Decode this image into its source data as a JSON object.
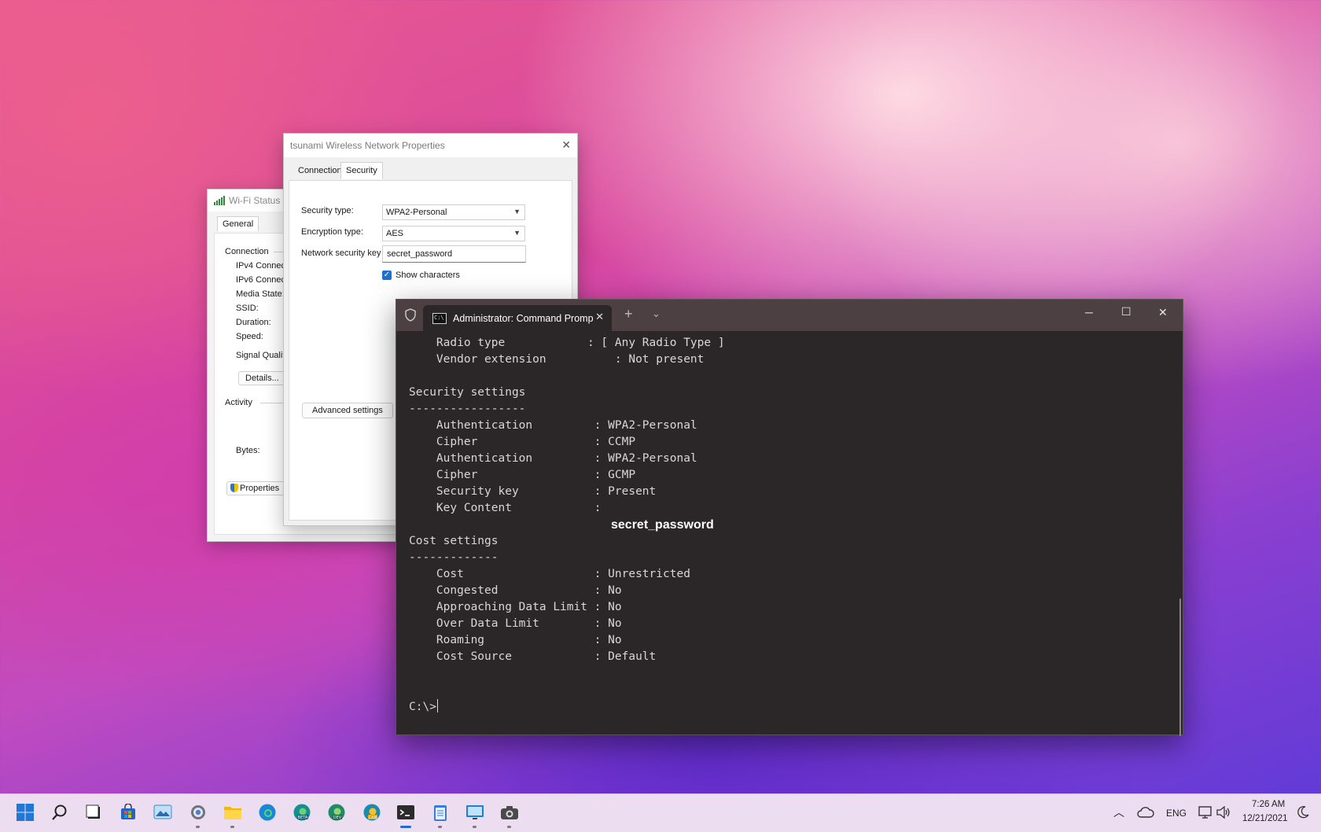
{
  "wifi_status": {
    "title": "Wi-Fi Status",
    "tab": "General",
    "connection_label": "Connection",
    "rows": [
      "IPv4 Connec",
      "IPv6 Connec",
      "Media State:",
      "SSID:",
      "Duration:",
      "Speed:"
    ],
    "signal_label": "Signal Quality",
    "details_button": "Details...",
    "activity_label": "Activity",
    "bytes_label": "Bytes:",
    "properties_button": "Properties"
  },
  "properties_dialog": {
    "title": "tsunami Wireless Network Properties",
    "tabs": [
      "Connection",
      "Security"
    ],
    "active_tab": "Security",
    "security_type_label": "Security type:",
    "security_type_value": "WPA2-Personal",
    "encryption_type_label": "Encryption type:",
    "encryption_type_value": "AES",
    "network_key_label": "Network security key",
    "network_key_value": "secret_password",
    "show_characters_label": "Show characters",
    "show_characters_checked": true,
    "advanced_button": "Advanced settings"
  },
  "terminal": {
    "tab_title": "Administrator: Command Promp",
    "lines": [
      "    Radio type            : [ Any Radio Type ]",
      "    Vendor extension          : Not present",
      "",
      "Security settings",
      "-----------------",
      "    Authentication         : WPA2-Personal",
      "    Cipher                 : CCMP",
      "    Authentication         : WPA2-Personal",
      "    Cipher                 : GCMP",
      "    Security key           : Present",
      "    Key Content            :",
      "",
      "Cost settings",
      "-------------",
      "    Cost                   : Unrestricted",
      "    Congested              : No",
      "    Approaching Data Limit : No",
      "    Over Data Limit        : No",
      "    Roaming                : No",
      "    Cost Source            : Default"
    ],
    "key_content_highlight": "secret_password",
    "prompt": "C:\\>"
  },
  "taskbar": {
    "icons": [
      "start-icon",
      "search-icon",
      "task-view-icon",
      "store-icon",
      "photos-icon",
      "settings-icon",
      "file-explorer-icon",
      "edge-icon",
      "edge-beta-icon",
      "edge-dev-icon",
      "edge-canary-icon",
      "terminal-icon",
      "notepad-icon",
      "remote-desktop-icon",
      "camera-icon"
    ],
    "language": "ENG",
    "time": "7:26 AM",
    "date": "12/21/2021"
  },
  "colors": {
    "accent": "#1f6fd1",
    "terminal_bg": "#2b2628",
    "terminal_tabbar": "#4c4042"
  }
}
